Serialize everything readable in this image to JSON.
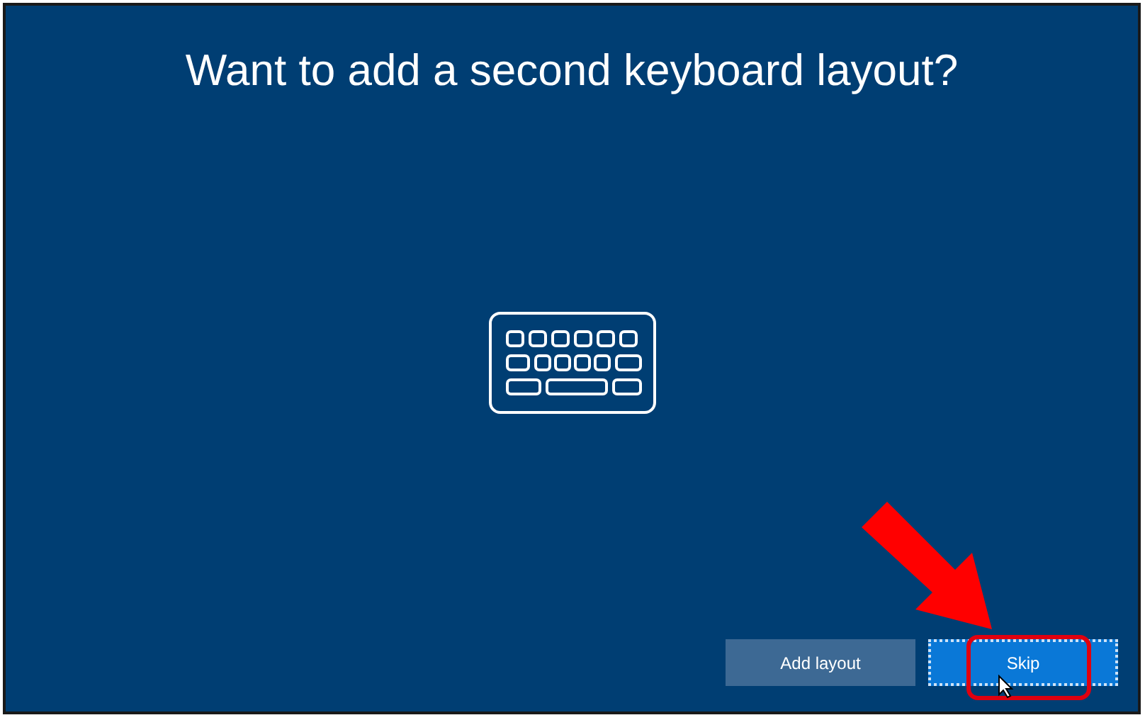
{
  "title": "Want to add a second keyboard layout?",
  "buttons": [
    {
      "label": "Add layout",
      "kind": "secondary",
      "focused": false
    },
    {
      "label": "Skip",
      "kind": "primary",
      "focused": true
    }
  ]
}
